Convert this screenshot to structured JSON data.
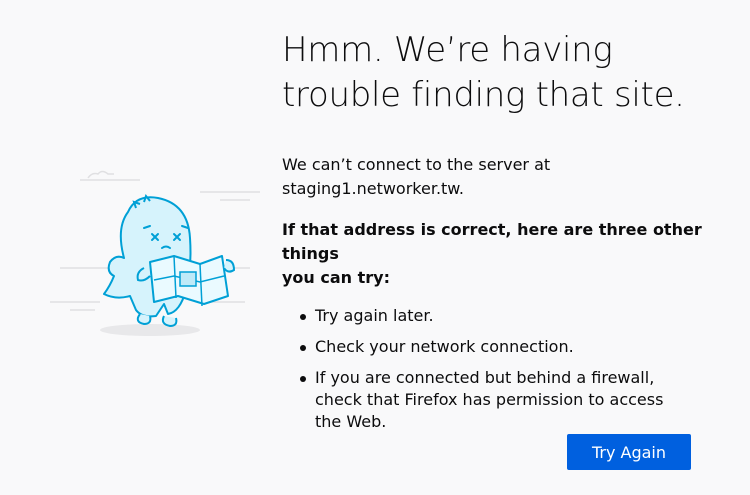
{
  "error_page": {
    "title_line1": "Hmm. We’re having",
    "title_line2": "trouble finding that site.",
    "description_line1": "We can’t connect to the server at",
    "description_line2": "staging1.networker.tw.",
    "advice_title_line1": "If that address is correct, here are three other things",
    "advice_title_line2": "you can try:",
    "advice_items": [
      "Try again later.",
      "Check your network connection.",
      "If you are connected but behind a firewall, check that Firefox has permission to access the Web."
    ],
    "try_again_label": "Try Again"
  },
  "colors": {
    "background": "#f9f9fa",
    "button": "#0060df",
    "illustration_stroke": "#00a0d6",
    "illustration_fill": "#d6f3fc"
  },
  "icons": {
    "illustration": "dino-with-map-illustration"
  }
}
